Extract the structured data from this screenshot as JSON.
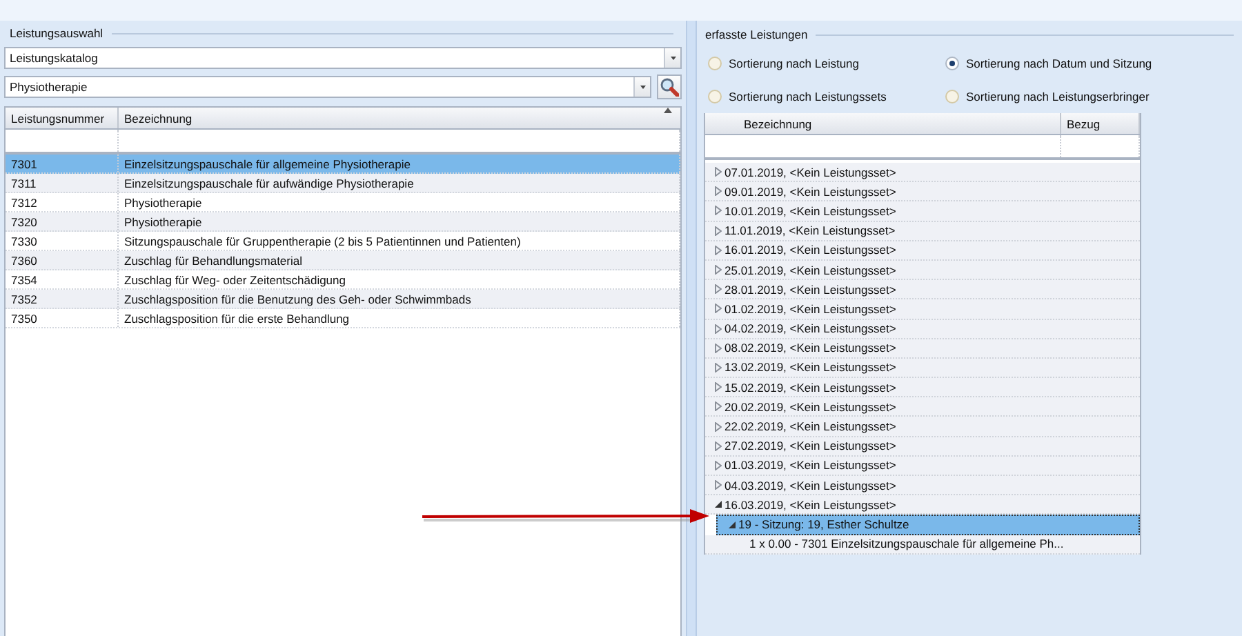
{
  "left_panel": {
    "title": "Leistungsauswahl",
    "catalog_dropdown": {
      "value": "Leistungskatalog"
    },
    "category_dropdown": {
      "value": "Physiotherapie"
    },
    "table": {
      "columns": [
        "Leistungsnummer",
        "Bezeichnung"
      ],
      "rows": [
        {
          "number": "7301",
          "name": "Einzelsitzungspauschale für allgemeine Physiotherapie",
          "selected": true
        },
        {
          "number": "7311",
          "name": "Einzelsitzungspauschale für aufwändige Physiotherapie",
          "selected": false
        },
        {
          "number": "7312",
          "name": "Physiotherapie",
          "selected": false
        },
        {
          "number": "7320",
          "name": "Physiotherapie",
          "selected": false
        },
        {
          "number": "7330",
          "name": "Sitzungspauschale für Gruppentherapie (2 bis 5 Patientinnen und Patienten)",
          "selected": false
        },
        {
          "number": "7360",
          "name": "Zuschlag für Behandlungsmaterial",
          "selected": false
        },
        {
          "number": "7354",
          "name": "Zuschlag für Weg- oder Zeitentschädigung",
          "selected": false
        },
        {
          "number": "7352",
          "name": "Zuschlagsposition für die Benutzung des Geh- oder Schwimmbads",
          "selected": false
        },
        {
          "number": "7350",
          "name": "Zuschlagsposition für die erste Behandlung",
          "selected": false
        }
      ]
    }
  },
  "right_panel": {
    "title": "erfasste Leistungen",
    "sort_options": [
      {
        "label": "Sortierung nach Leistung",
        "selected": false
      },
      {
        "label": "Sortierung nach Datum und Sitzung",
        "selected": true
      },
      {
        "label": "Sortierung nach Leistungssets",
        "selected": false
      },
      {
        "label": "Sortierung nach Leistungserbringer",
        "selected": false
      }
    ],
    "tree": {
      "columns": [
        "Bezeichnung",
        "Bezug"
      ],
      "items": [
        {
          "label": "07.01.2019, <Kein Leistungsset>",
          "expanded": false,
          "selected": false
        },
        {
          "label": "09.01.2019, <Kein Leistungsset>",
          "expanded": false,
          "selected": false
        },
        {
          "label": "10.01.2019, <Kein Leistungsset>",
          "expanded": false,
          "selected": false
        },
        {
          "label": "11.01.2019, <Kein Leistungsset>",
          "expanded": false,
          "selected": false
        },
        {
          "label": "16.01.2019, <Kein Leistungsset>",
          "expanded": false,
          "selected": false
        },
        {
          "label": "25.01.2019, <Kein Leistungsset>",
          "expanded": false,
          "selected": false
        },
        {
          "label": "28.01.2019, <Kein Leistungsset>",
          "expanded": false,
          "selected": false
        },
        {
          "label": "01.02.2019, <Kein Leistungsset>",
          "expanded": false,
          "selected": false
        },
        {
          "label": "04.02.2019, <Kein Leistungsset>",
          "expanded": false,
          "selected": false
        },
        {
          "label": "08.02.2019, <Kein Leistungsset>",
          "expanded": false,
          "selected": false
        },
        {
          "label": "13.02.2019, <Kein Leistungsset>",
          "expanded": false,
          "selected": false
        },
        {
          "label": "15.02.2019, <Kein Leistungsset>",
          "expanded": false,
          "selected": false
        },
        {
          "label": "20.02.2019, <Kein Leistungsset>",
          "expanded": false,
          "selected": false
        },
        {
          "label": "22.02.2019, <Kein Leistungsset>",
          "expanded": false,
          "selected": false
        },
        {
          "label": "27.02.2019, <Kein Leistungsset>",
          "expanded": false,
          "selected": false
        },
        {
          "label": "01.03.2019, <Kein Leistungsset>",
          "expanded": false,
          "selected": false
        },
        {
          "label": "04.03.2019, <Kein Leistungsset>",
          "expanded": false,
          "selected": false
        },
        {
          "label": "16.03.2019, <Kein Leistungsset>",
          "expanded": true,
          "selected": false,
          "children": [
            {
              "label": "19 - Sitzung: 19, Esther Schultze",
              "expanded": true,
              "selected": true,
              "children": [
                {
                  "label": "1 x 0.00 - 7301 Einzelsitzungspauschale für allgemeine Ph...",
                  "selected": false
                }
              ]
            }
          ]
        }
      ]
    }
  }
}
